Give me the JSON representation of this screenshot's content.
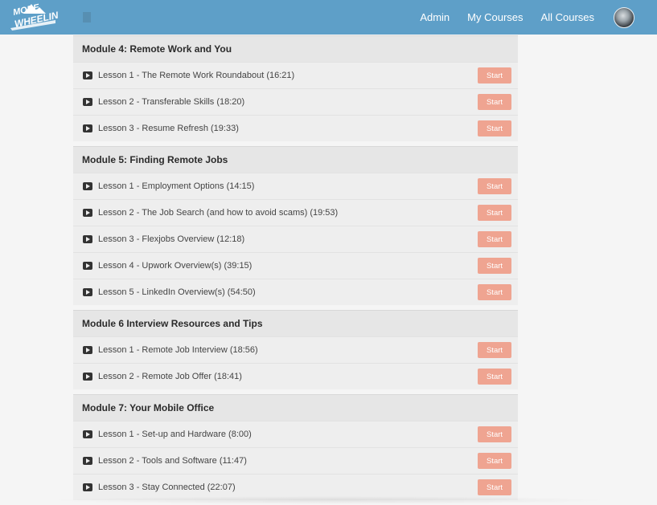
{
  "header": {
    "logo_text": "MORE THAN A WHEELIN'",
    "background_color": "#5e9fc8",
    "nav": [
      {
        "label": "Admin"
      },
      {
        "label": "My Courses"
      },
      {
        "label": "All Courses"
      }
    ]
  },
  "accent_color": "#efa491",
  "modules": [
    {
      "title": "Module 4: Remote Work and You",
      "lessons": [
        {
          "title": "Lesson 1 - The Remote Work Roundabout (16:21)",
          "button": "Start"
        },
        {
          "title": "Lesson 2 - Transferable Skills (18:20)",
          "button": "Start"
        },
        {
          "title": "Lesson 3 - Resume Refresh (19:33)",
          "button": "Start"
        }
      ]
    },
    {
      "title": "Module 5: Finding Remote Jobs",
      "lessons": [
        {
          "title": "Lesson 1 - Employment Options (14:15)",
          "button": "Start"
        },
        {
          "title": "Lesson 2 - The Job Search (and how to avoid scams) (19:53)",
          "button": "Start"
        },
        {
          "title": "Lesson 3 - Flexjobs Overview (12:18)",
          "button": "Start"
        },
        {
          "title": "Lesson 4 - Upwork Overview(s) (39:15)",
          "button": "Start"
        },
        {
          "title": "Lesson 5 - LinkedIn Overview(s) (54:50)",
          "button": "Start"
        }
      ]
    },
    {
      "title": "Module 6 Interview Resources and Tips",
      "lessons": [
        {
          "title": "Lesson 1 - Remote Job Interview (18:56)",
          "button": "Start"
        },
        {
          "title": "Lesson 2 - Remote Job Offer (18:41)",
          "button": "Start"
        }
      ]
    },
    {
      "title": "Module 7: Your Mobile Office",
      "lessons": [
        {
          "title": "Lesson 1 - Set-up and Hardware (8:00)",
          "button": "Start"
        },
        {
          "title": "Lesson 2 - Tools and Software (11:47)",
          "button": "Start"
        },
        {
          "title": "Lesson 3 - Stay Connected (22:07)",
          "button": "Start"
        }
      ]
    }
  ]
}
